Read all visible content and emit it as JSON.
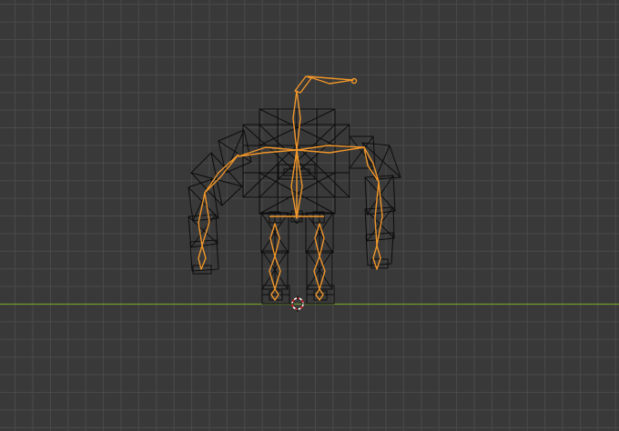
{
  "viewport": {
    "view": "front-orthographic",
    "display_mode": "wireframe",
    "background_color": "#393939",
    "grid_color": "#4a4a4a",
    "x_axis_color": "#6f9a2c",
    "mesh_wire_color": "#000000",
    "armature_color": "#f0962a",
    "cursor_ring_colors": [
      "#e02020",
      "#ffffff"
    ]
  },
  "scene": {
    "objects": [
      {
        "name_icon": "robot-mesh-wireframe",
        "type": "mesh"
      },
      {
        "name_icon": "armature-bones",
        "type": "armature"
      },
      {
        "name_icon": "3d-cursor-icon",
        "type": "cursor"
      }
    ]
  }
}
